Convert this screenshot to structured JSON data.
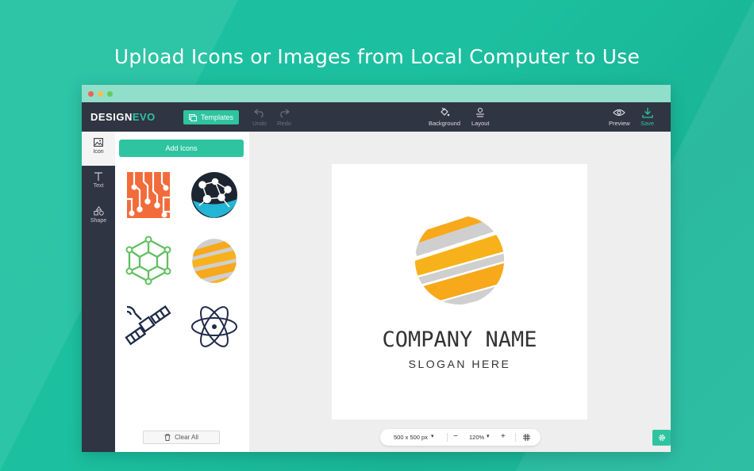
{
  "headline": "Upload Icons or Images from Local Computer to Use",
  "app": {
    "brand_design": "DESIGN",
    "brand_evo": "EVO",
    "templates_label": "Templates",
    "toolbar": {
      "undo": "Undo",
      "redo": "Redo",
      "background": "Background",
      "layout": "Layout",
      "preview": "Preview",
      "save": "Save"
    }
  },
  "sidebar": {
    "tabs": [
      {
        "label": "Icon",
        "icon": "image-icon",
        "active": true
      },
      {
        "label": "Text",
        "icon": "text-icon",
        "active": false
      },
      {
        "label": "Shape",
        "icon": "shapes-icon",
        "active": false
      }
    ]
  },
  "panel": {
    "add_icons_label": "Add Icons",
    "clear_all_label": "Clear All",
    "icons": [
      "circuit-board-icon",
      "globe-network-icon",
      "hexagon-molecule-icon",
      "striped-sphere-icon",
      "satellite-icon",
      "atom-icon"
    ]
  },
  "canvas": {
    "company_name": "COMPANY NAME",
    "slogan": "SLOGAN HERE",
    "size_label": "500 x 500 px",
    "zoom_label": "120%",
    "zoom_minus": "−",
    "zoom_plus": "+"
  },
  "colors": {
    "accent": "#2ec4a0",
    "topbar": "#2f3542",
    "logo_orange": "#f7a81b",
    "logo_gray": "#cfcfcf"
  }
}
